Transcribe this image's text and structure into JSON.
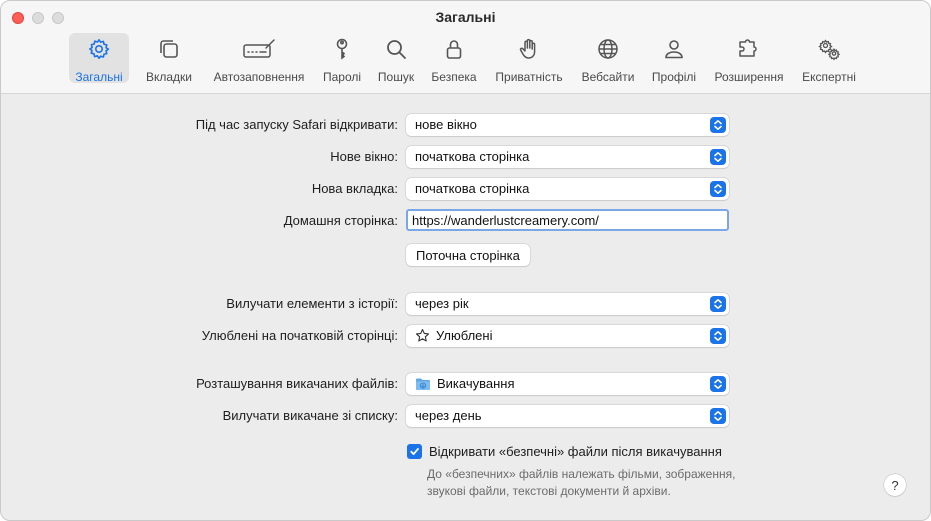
{
  "window": {
    "title": "Загальні"
  },
  "toolbar": {
    "tabs": [
      {
        "label": "Загальні",
        "icon": "gear-icon",
        "active": true
      },
      {
        "label": "Вкладки",
        "icon": "tabs-icon"
      },
      {
        "label": "Автозаповнення",
        "icon": "autofill-icon"
      },
      {
        "label": "Паролі",
        "icon": "key-icon"
      },
      {
        "label": "Пошук",
        "icon": "search-icon"
      },
      {
        "label": "Безпека",
        "icon": "lock-icon"
      },
      {
        "label": "Приватність",
        "icon": "hand-icon"
      },
      {
        "label": "Вебсайти",
        "icon": "globe-icon"
      },
      {
        "label": "Профілі",
        "icon": "person-icon"
      },
      {
        "label": "Розширення",
        "icon": "puzzle-icon"
      },
      {
        "label": "Експертні",
        "icon": "gears-icon"
      }
    ]
  },
  "general": {
    "open_with_label": "Під час запуску Safari відкривати:",
    "open_with_value": "нове вікно",
    "new_window_label": "Нове вікно:",
    "new_window_value": "початкова сторінка",
    "new_tab_label": "Нова вкладка:",
    "new_tab_value": "початкова сторінка",
    "homepage_label": "Домашня сторінка:",
    "homepage_value": "https://wanderlustcreamery.com/",
    "current_page_button": "Поточна сторінка",
    "remove_history_label": "Вилучати елементи з історії:",
    "remove_history_value": "через рік",
    "favorites_label": "Улюблені на початковій сторінці:",
    "favorites_value": "Улюблені",
    "download_location_label": "Розташування викачаних файлів:",
    "download_location_value": "Викачування",
    "remove_downloads_label": "Вилучати викачане зі списку:",
    "remove_downloads_value": "через день",
    "open_safe_files_label": "Відкривати «безпечні» файли після викачування",
    "open_safe_files_checked": true,
    "safe_files_note_line1": "До «безпечних» файлів належать фільми, зображення,",
    "safe_files_note_line2": "звукові файли, текстові документи й архіви.",
    "help_label": "?"
  },
  "colors": {
    "accent": "#1a73e8",
    "close": "#fe5f57"
  }
}
